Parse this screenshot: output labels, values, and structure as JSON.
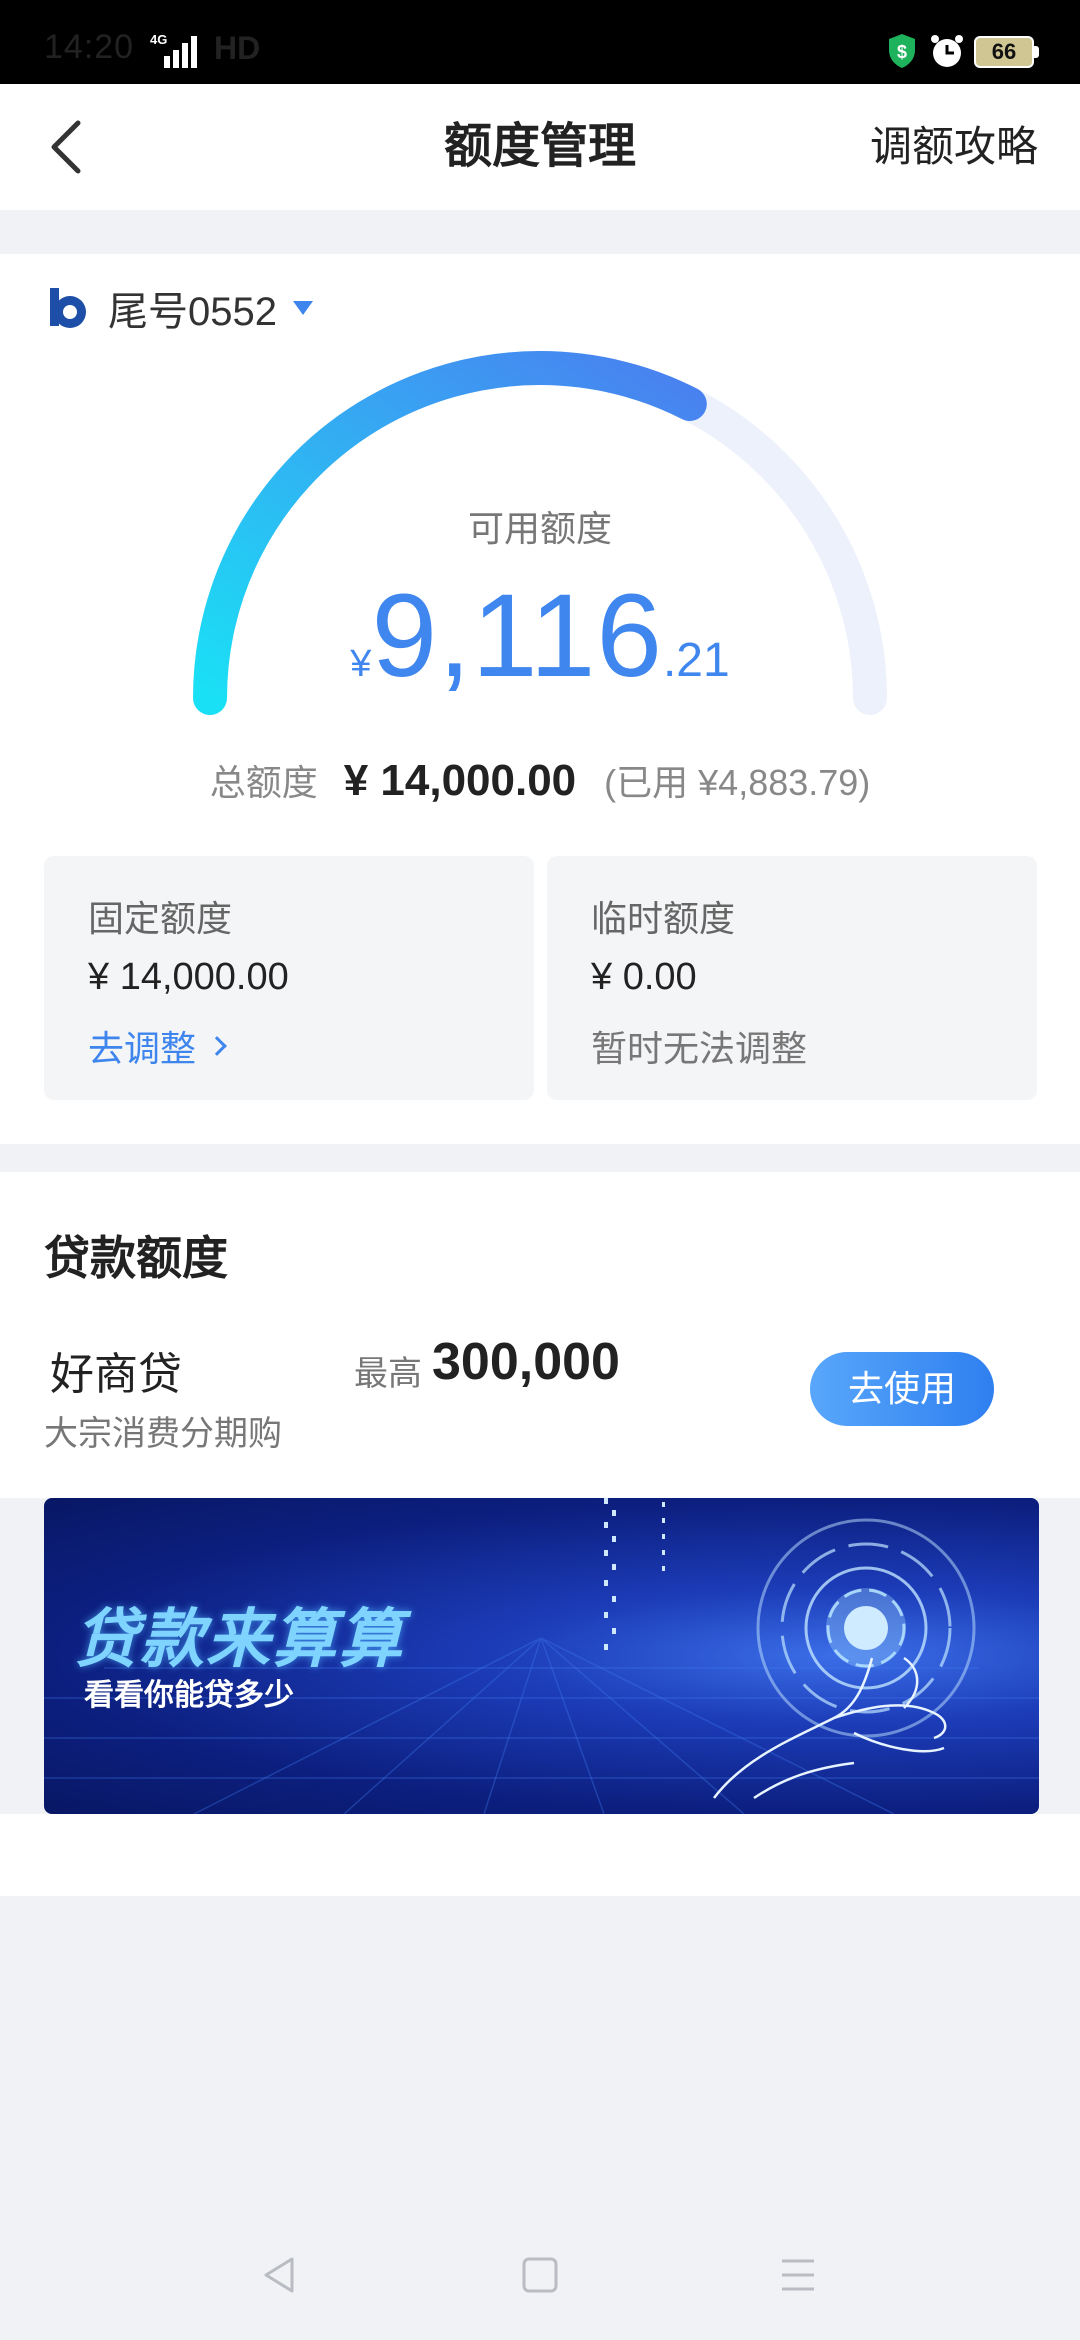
{
  "status_bar": {
    "time": "14:20",
    "network": "4G",
    "hd": "HD",
    "battery": "66"
  },
  "header": {
    "title": "额度管理",
    "link": "调额攻略"
  },
  "account": {
    "label": "尾号0552"
  },
  "credit": {
    "available_label": "可用额度",
    "currency": "¥",
    "available_int": "9,116",
    "available_dec": ".21",
    "available_fraction": 0.65,
    "total_label": "总额度",
    "total_value": "¥ 14,000.00",
    "used_text": "(已用 ¥4,883.79)"
  },
  "fixed": {
    "title": "固定额度",
    "value": "¥ 14,000.00",
    "action": "去调整"
  },
  "temp": {
    "title": "临时额度",
    "value": "¥ 0.00",
    "action": "暂时无法调整"
  },
  "loan": {
    "heading": "贷款额度",
    "product_name": "好商贷",
    "product_desc": "大宗消费分期购",
    "max_label": "最高",
    "max_value": "300,000",
    "button": "去使用"
  },
  "banner": {
    "title": "贷款来算算",
    "subtitle": "看看你能贷多少"
  },
  "colors": {
    "accent": "#3f86ee",
    "gauge_start": "#1ae0f5",
    "gauge_end": "#4a7ff0",
    "gauge_track": "#edf1fc"
  }
}
